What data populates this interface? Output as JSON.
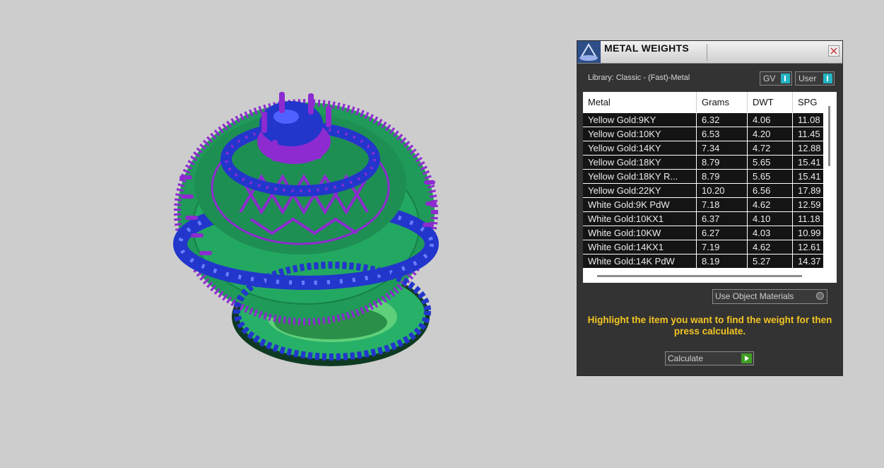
{
  "window": {
    "title": "METAL WEIGHTS"
  },
  "library_label": "Library: Classic - (Fast)-Metal",
  "buttons": {
    "gv": "GV",
    "user": "User",
    "use_object_materials": "Use Object Materials",
    "calculate": "Calculate"
  },
  "table": {
    "columns": [
      "Metal",
      "Grams",
      "DWT",
      "SPG"
    ],
    "rows": [
      [
        "Yellow Gold:9KY",
        "6.32",
        "4.06",
        "11.08"
      ],
      [
        "Yellow Gold:10KY",
        "6.53",
        "4.20",
        "11.45"
      ],
      [
        "Yellow Gold:14KY",
        "7.34",
        "4.72",
        "12.88"
      ],
      [
        "Yellow Gold:18KY",
        "8.79",
        "5.65",
        "15.41"
      ],
      [
        "Yellow Gold:18KY R...",
        "8.79",
        "5.65",
        "15.41"
      ],
      [
        "Yellow Gold:22KY",
        "10.20",
        "6.56",
        "17.89"
      ],
      [
        "White Gold:9K PdW",
        "7.18",
        "4.62",
        "12.59"
      ],
      [
        "White Gold:10KX1",
        "6.37",
        "4.10",
        "11.18"
      ],
      [
        "White Gold:10KW",
        "6.27",
        "4.03",
        "10.99"
      ],
      [
        "White Gold:14KX1",
        "7.19",
        "4.62",
        "12.61"
      ],
      [
        "White Gold:14K PdW",
        "8.19",
        "5.27",
        "14.37"
      ]
    ]
  },
  "hint": "Highlight the item you want to find the weight for then press calculate.",
  "colors": {
    "band": "#23a862",
    "prong": "#8d2bd0",
    "stone": "#2236cc",
    "panel": "#333333",
    "hint": "#f3c524",
    "accent": "#23b3c4"
  }
}
